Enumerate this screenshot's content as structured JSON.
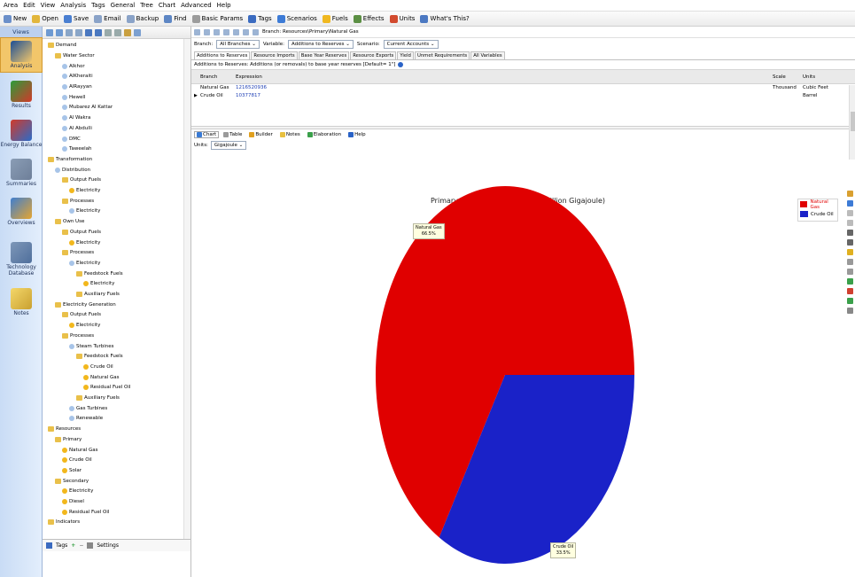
{
  "menu": [
    "Area",
    "Edit",
    "View",
    "Analysis",
    "Tags",
    "General",
    "Tree",
    "Chart",
    "Advanced",
    "Help"
  ],
  "toolbar": [
    {
      "label": "New",
      "icon": "new-icon",
      "color": "#6b8fc9"
    },
    {
      "label": "Open",
      "icon": "open-icon",
      "color": "#e2b63b"
    },
    {
      "label": "Save",
      "icon": "save-icon",
      "color": "#4a7fd1"
    },
    {
      "label": "Email",
      "icon": "email-icon",
      "color": "#8aa3c8"
    },
    {
      "label": "Backup",
      "icon": "backup-icon",
      "color": "#8aa3c8"
    },
    {
      "label": "Find",
      "icon": "find-icon",
      "color": "#5d86c4"
    },
    {
      "label": "Basic Params",
      "icon": "params-icon",
      "color": "#9c9c9c"
    },
    {
      "label": "Tags",
      "icon": "tags-icon",
      "color": "#3b6bc0"
    },
    {
      "label": "Scenarios",
      "icon": "scenarios-icon",
      "color": "#3d7bd6"
    },
    {
      "label": "Fuels",
      "icon": "fuels-icon",
      "color": "#f0b820"
    },
    {
      "label": "Effects",
      "icon": "effects-icon",
      "color": "#5b8f43"
    },
    {
      "label": "Units",
      "icon": "units-icon",
      "color": "#d24a2e"
    },
    {
      "label": "What's This?",
      "icon": "whats-this-icon",
      "color": "#4c79c2"
    }
  ],
  "nav": {
    "header": "Views",
    "items": [
      {
        "label": "Analysis",
        "icon": "analysis-icon",
        "active": true
      },
      {
        "label": "Results",
        "icon": "results-icon"
      },
      {
        "label": "Energy Balance",
        "icon": "energy-balance-icon"
      },
      {
        "label": "Summaries",
        "icon": "summaries-icon"
      },
      {
        "label": "Overviews",
        "icon": "overviews-icon"
      },
      {
        "label": "Technology Database",
        "icon": "technology-database-icon"
      },
      {
        "label": "Notes",
        "icon": "notes-icon"
      }
    ]
  },
  "tree": [
    {
      "label": "Demand",
      "depth": 0,
      "type": "folder"
    },
    {
      "label": "Water Sector",
      "depth": 1,
      "type": "folder"
    },
    {
      "label": "Alkhor",
      "depth": 2,
      "type": "proc"
    },
    {
      "label": "AlKheraiti",
      "depth": 2,
      "type": "proc"
    },
    {
      "label": "AlRayyan",
      "depth": 2,
      "type": "proc"
    },
    {
      "label": "Hewell",
      "depth": 2,
      "type": "proc"
    },
    {
      "label": "Mubarez Al Kattar",
      "depth": 2,
      "type": "proc"
    },
    {
      "label": "Al Wakra",
      "depth": 2,
      "type": "proc"
    },
    {
      "label": "Al Abdulli",
      "depth": 2,
      "type": "proc"
    },
    {
      "label": "DMC",
      "depth": 2,
      "type": "proc"
    },
    {
      "label": "Taweelah",
      "depth": 2,
      "type": "proc"
    },
    {
      "label": "Transformation",
      "depth": 0,
      "type": "folder"
    },
    {
      "label": "Distribution",
      "depth": 1,
      "type": "proc"
    },
    {
      "label": "Output Fuels",
      "depth": 2,
      "type": "folder"
    },
    {
      "label": "Electricity",
      "depth": 3,
      "type": "cyl"
    },
    {
      "label": "Processes",
      "depth": 2,
      "type": "folder"
    },
    {
      "label": "Electricity",
      "depth": 3,
      "type": "proc"
    },
    {
      "label": "Own Use",
      "depth": 1,
      "type": "folder"
    },
    {
      "label": "Output Fuels",
      "depth": 2,
      "type": "folder"
    },
    {
      "label": "Electricity",
      "depth": 3,
      "type": "cyl"
    },
    {
      "label": "Processes",
      "depth": 2,
      "type": "folder"
    },
    {
      "label": "Electricity",
      "depth": 3,
      "type": "proc"
    },
    {
      "label": "Feedstock Fuels",
      "depth": 4,
      "type": "folder"
    },
    {
      "label": "Electricity",
      "depth": 5,
      "type": "cyl"
    },
    {
      "label": "Auxiliary Fuels",
      "depth": 4,
      "type": "folder"
    },
    {
      "label": "Electricity Generation",
      "depth": 1,
      "type": "folder"
    },
    {
      "label": "Output Fuels",
      "depth": 2,
      "type": "folder"
    },
    {
      "label": "Electricity",
      "depth": 3,
      "type": "cyl"
    },
    {
      "label": "Processes",
      "depth": 2,
      "type": "folder"
    },
    {
      "label": "Steam Turbines",
      "depth": 3,
      "type": "proc"
    },
    {
      "label": "Feedstock Fuels",
      "depth": 4,
      "type": "folder"
    },
    {
      "label": "Crude Oil",
      "depth": 5,
      "type": "cyl"
    },
    {
      "label": "Natural Gas",
      "depth": 5,
      "type": "cyl"
    },
    {
      "label": "Residual Fuel Oil",
      "depth": 5,
      "type": "cyl"
    },
    {
      "label": "Auxiliary Fuels",
      "depth": 4,
      "type": "folder"
    },
    {
      "label": "Gas Turbines",
      "depth": 3,
      "type": "proc"
    },
    {
      "label": "Renewable",
      "depth": 3,
      "type": "proc"
    },
    {
      "label": "Resources",
      "depth": 0,
      "type": "folder"
    },
    {
      "label": "Primary",
      "depth": 1,
      "type": "folder"
    },
    {
      "label": "Natural Gas",
      "depth": 2,
      "type": "cyl"
    },
    {
      "label": "Crude Oil",
      "depth": 2,
      "type": "cyl"
    },
    {
      "label": "Solar",
      "depth": 2,
      "type": "cyl"
    },
    {
      "label": "Secondary",
      "depth": 1,
      "type": "folder"
    },
    {
      "label": "Electricity",
      "depth": 2,
      "type": "cyl"
    },
    {
      "label": "Diesel",
      "depth": 2,
      "type": "cyl"
    },
    {
      "label": "Residual Fuel Oil",
      "depth": 2,
      "type": "cyl"
    },
    {
      "label": "Indicators",
      "depth": 0,
      "type": "folder"
    }
  ],
  "tree_bottom": {
    "tags_label": "Tags",
    "settings_label": "Settings"
  },
  "selectors": {
    "branch_label": "Branch:",
    "branch_value": "All Branches",
    "variable_label": "Variable:",
    "variable_value": "Additions to Reserves",
    "scenario_label": "Scenario:",
    "scenario_value": "Current Accounts",
    "breadcrumb": "Branch: Resources\\Primary\\Natural Gas"
  },
  "variable_tabs": [
    {
      "label": "Additions to Reserves",
      "active": true
    },
    {
      "label": "Resource Imports"
    },
    {
      "label": "Base Year Reserves"
    },
    {
      "label": "Resource Exports"
    },
    {
      "label": "Yield"
    },
    {
      "label": "Unmet Requirements"
    },
    {
      "label": "All Variables"
    }
  ],
  "description": "Additions to Reserves: Additions (or removals) to base year reserves [Default= 1\"]",
  "grid": {
    "headers": {
      "branch": "Branch",
      "expression": "Expression",
      "scale": "Scale",
      "units": "Units"
    },
    "rows": [
      {
        "branch": "Natural Gas",
        "expression": "1216520936",
        "scale": "Thousand",
        "units": "Cubic Feet"
      },
      {
        "branch": "Crude Oil",
        "expression": "10377817",
        "scale": "",
        "units": "Barrel"
      }
    ]
  },
  "bottom_tabs": [
    {
      "label": "Chart",
      "active": true,
      "color": "#3a7bd5"
    },
    {
      "label": "Table",
      "color": "#9a9a9a"
    },
    {
      "label": "Builder",
      "color": "#e0a020"
    },
    {
      "label": "Notes",
      "color": "#e8c040"
    },
    {
      "label": "Elaboration",
      "color": "#3aa04a"
    },
    {
      "label": "Help",
      "color": "#2a63c7"
    }
  ],
  "units": {
    "label": "Units:",
    "value": "Gigajoule"
  },
  "chart_data": {
    "type": "pie",
    "title": "Primary: Additions to Reserves (Million Gigajoule)",
    "labels": [
      "Natural Gas",
      "Crude Oil"
    ],
    "values": [
      66.5,
      33.5
    ],
    "value_labels": [
      "66.5%",
      "33.5%"
    ],
    "colors": [
      "#e00000",
      "#1a22c8"
    ],
    "legend": "top-right"
  }
}
